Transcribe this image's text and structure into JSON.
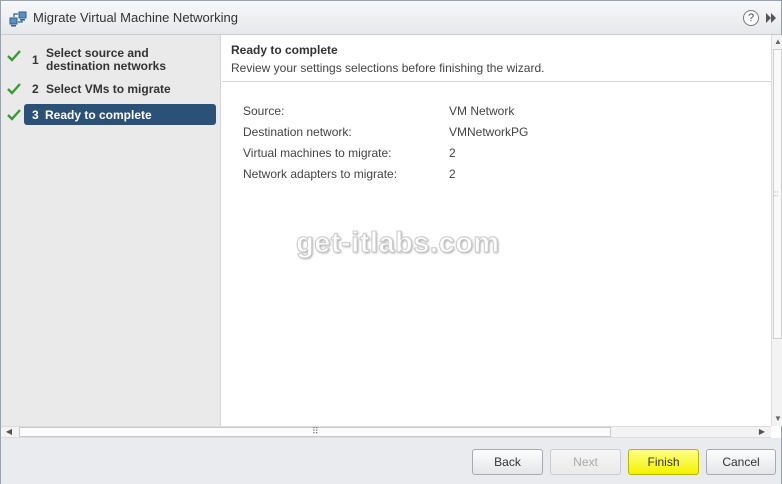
{
  "window": {
    "title": "Migrate Virtual Machine Networking",
    "help_glyph": "?"
  },
  "nav": {
    "steps": [
      {
        "number": "1",
        "label_line1": "Select source and",
        "label_line2": "destination networks",
        "completed": true,
        "active": false
      },
      {
        "number": "2",
        "label": "Select VMs to migrate",
        "completed": true,
        "active": false
      },
      {
        "number": "3",
        "label": "Ready to complete",
        "completed": true,
        "active": true
      }
    ]
  },
  "content": {
    "title": "Ready to complete",
    "subtitle": "Review your settings selections before finishing the wizard.",
    "summary": [
      {
        "key": "Source:",
        "value": "VM Network"
      },
      {
        "key": "Destination network:",
        "value": "VMNetworkPG"
      },
      {
        "key": "Virtual machines to migrate:",
        "value": "2"
      },
      {
        "key": "Network adapters to migrate:",
        "value": "2"
      }
    ],
    "watermark": "get-itlabs.com"
  },
  "footer": {
    "back_label": "Back",
    "next_label": "Next",
    "finish_label": "Finish",
    "cancel_label": "Cancel"
  },
  "colors": {
    "active_step": "#2b5177",
    "check": "#3a9a3a",
    "finish_button": "#f4f200"
  }
}
